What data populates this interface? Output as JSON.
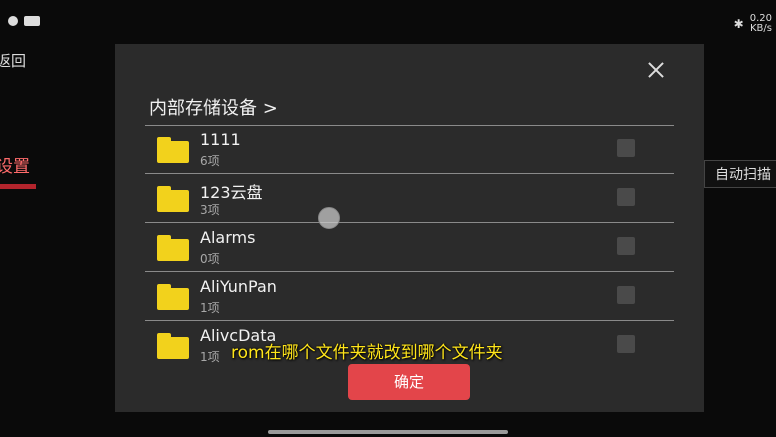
{
  "status_bar": {
    "left_icons": [
      "record-dot-icon",
      "video-camera-icon"
    ],
    "bluetooth_icon": "bluetooth-icon",
    "speed_value": "0.20",
    "speed_unit": "KB/s"
  },
  "background": {
    "back_label": "返回",
    "settings_label": "设置",
    "auto_scan_label": "自动扫描"
  },
  "dialog": {
    "path_label": "内部存储设备 >",
    "close_icon": "close-icon",
    "items": [
      {
        "name": "1111",
        "count": "6项"
      },
      {
        "name": "123云盘",
        "count": "3项"
      },
      {
        "name": "Alarms",
        "count": "0项"
      },
      {
        "name": "AliYunPan",
        "count": "1项"
      },
      {
        "name": "AlivcData",
        "count": "1项"
      }
    ],
    "confirm_label": "确定"
  },
  "subtitle": "rom在哪个文件夹就改到哪个文件夹",
  "colors": {
    "accent": "#e3454a",
    "folder": "#f2d21c",
    "subtitle": "#ffe51a"
  }
}
